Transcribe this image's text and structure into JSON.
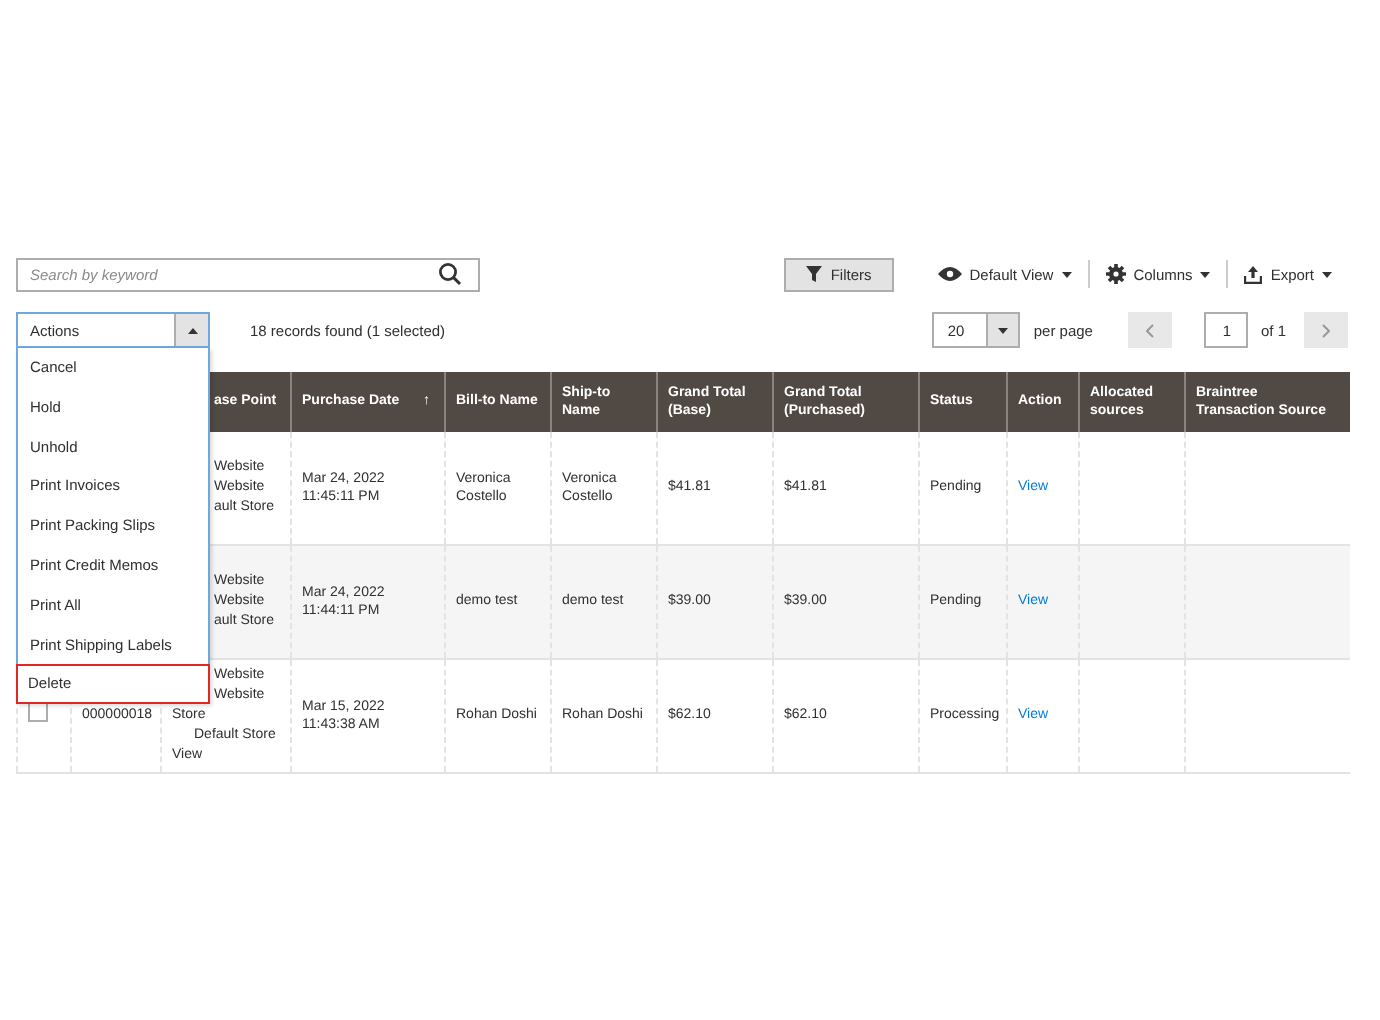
{
  "toolbar": {
    "search": {
      "placeholder": "Search by keyword"
    },
    "filters": "Filters",
    "default_view": "Default View",
    "columns": "Columns",
    "export": "Export"
  },
  "actions": {
    "label": "Actions",
    "expanded": true,
    "menu": [
      {
        "label": "Cancel",
        "selected": false
      },
      {
        "label": "Hold",
        "selected": false
      },
      {
        "label": "Unhold",
        "selected": false
      },
      {
        "label": "Print Invoices",
        "selected": false
      },
      {
        "label": "Print Packing Slips",
        "selected": false
      },
      {
        "label": "Print Credit Memos",
        "selected": false
      },
      {
        "label": "Print All",
        "selected": false
      },
      {
        "label": "Print Shipping Labels",
        "selected": false
      },
      {
        "label": "Delete",
        "selected": true
      }
    ]
  },
  "records": "18 records found (1 selected)",
  "pager": {
    "per_page_value": "20",
    "per_page_label": "per page",
    "page": "1",
    "of": "of 1"
  },
  "table": {
    "columns": [
      {},
      {},
      {
        "label": "ase Point",
        "kind": "cut"
      },
      {
        "label": "Purchase Date",
        "sort": "↑"
      },
      {
        "label": "Bill-to Name"
      },
      {
        "label": "Ship-to Name"
      },
      {
        "label": "Grand Total (Base)"
      },
      {
        "label": "Grand Total (Purchased)"
      },
      {
        "label": "Status"
      },
      {
        "label": "Action"
      },
      {
        "label": "Allocated sources"
      },
      {
        "label": "Braintree Transaction Source"
      }
    ],
    "rows": [
      {
        "purchase_point": [
          {
            "text": "Website",
            "kind": "cut"
          },
          {
            "text": "Website",
            "kind": "cut"
          },
          {
            "text": "ault Store",
            "kind": "cut"
          }
        ],
        "purchase_date": "Mar 24, 2022 11:45:11 PM",
        "bill_to": "Veronica Costello",
        "ship_to": "Veronica Costello",
        "grand_total_base": "$41.81",
        "grand_total_purchased": "$41.81",
        "status": "Pending",
        "action": "View"
      },
      {
        "purchase_point": [
          {
            "text": "Website",
            "kind": "cut"
          },
          {
            "text": "Website",
            "kind": "cut"
          },
          {
            "text": "ault Store",
            "kind": "cut"
          }
        ],
        "purchase_date": "Mar 24, 2022 11:44:11 PM",
        "bill_to": "demo test",
        "ship_to": "demo test",
        "grand_total_base": "$39.00",
        "grand_total_purchased": "$39.00",
        "status": "Pending",
        "action": "View"
      },
      {
        "checked": false,
        "id": "000000018",
        "purchase_point": [
          {
            "text": "Website",
            "kind": "cut"
          },
          {
            "text": "Website",
            "kind": "cut"
          },
          {
            "text": "Store",
            "kind": "whole"
          },
          {
            "text": "Default Store",
            "kind": "indent"
          },
          {
            "text": "View",
            "kind": "whole"
          }
        ],
        "purchase_date": "Mar 15, 2022 11:43:38 AM",
        "bill_to": "Rohan Doshi",
        "ship_to": "Rohan Doshi",
        "grand_total_base": "$62.10",
        "grand_total_purchased": "$62.10",
        "status": "Processing",
        "action": "View"
      }
    ]
  }
}
